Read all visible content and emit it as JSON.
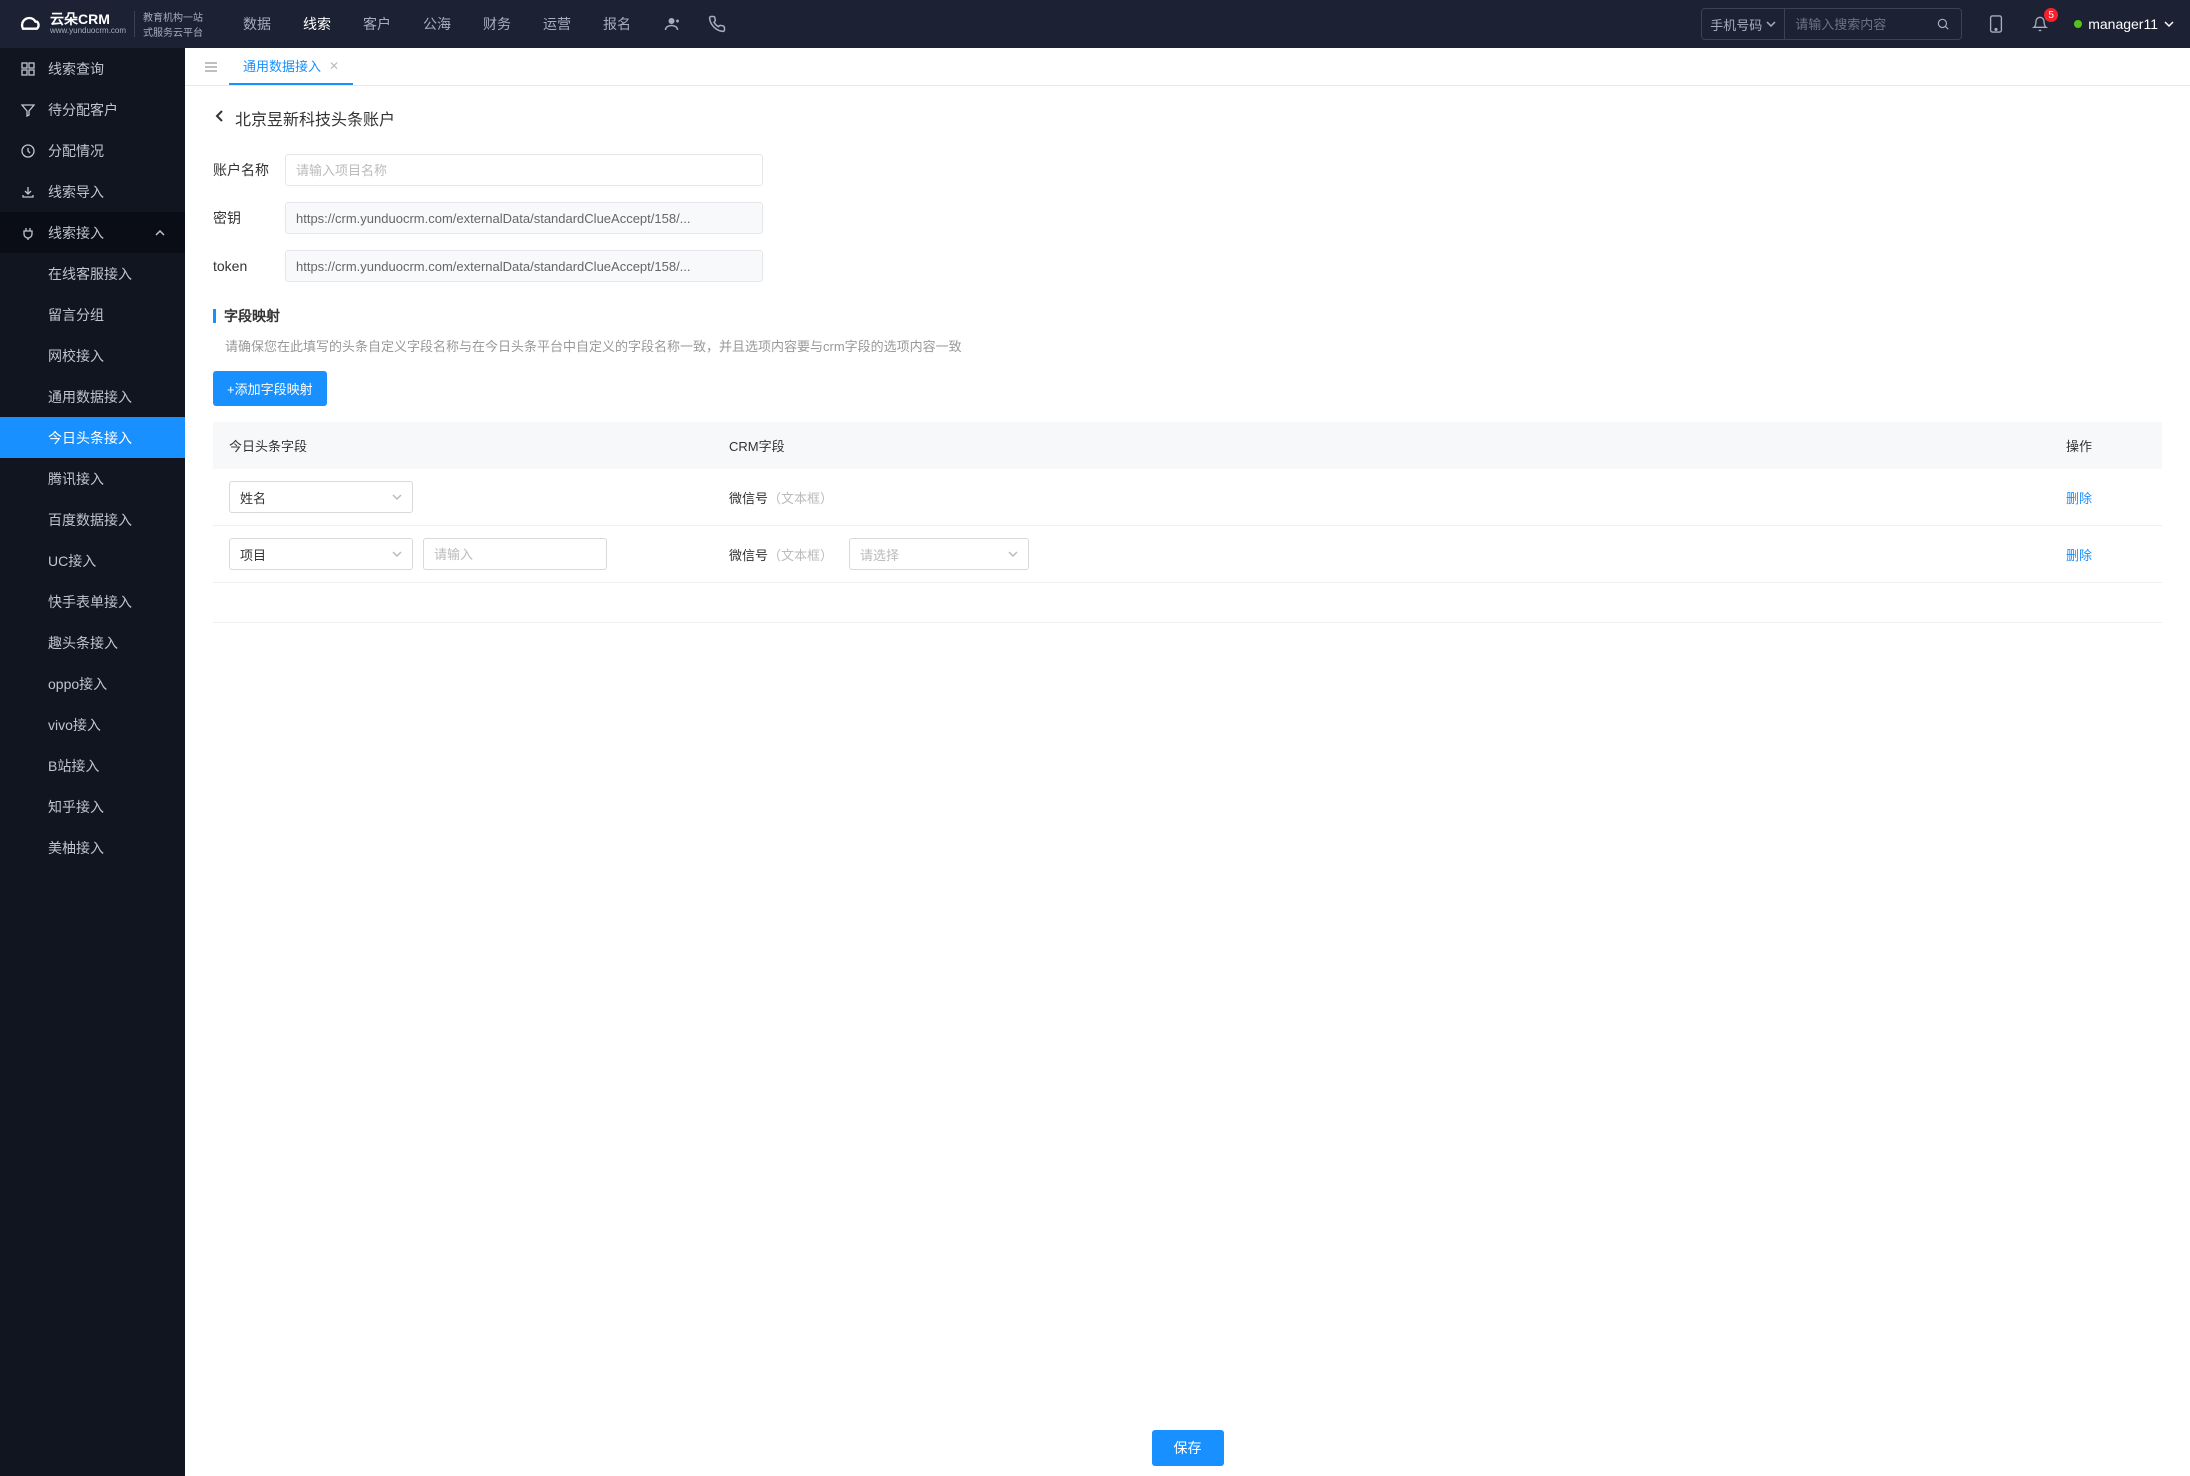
{
  "header": {
    "logo_main": "云朵CRM",
    "logo_sub_url": "www.yunduocrm.com",
    "logo_slogan1": "教育机构一站",
    "logo_slogan2": "式服务云平台",
    "nav": [
      "数据",
      "线索",
      "客户",
      "公海",
      "财务",
      "运营",
      "报名"
    ],
    "nav_active": 1,
    "search_type": "手机号码",
    "search_placeholder": "请输入搜索内容",
    "badge_count": "5",
    "user_name": "manager11"
  },
  "sidebar": {
    "items": [
      {
        "label": "线索查询",
        "icon": "grid"
      },
      {
        "label": "待分配客户",
        "icon": "filter"
      },
      {
        "label": "分配情况",
        "icon": "clock"
      },
      {
        "label": "线索导入",
        "icon": "export"
      },
      {
        "label": "线索接入",
        "icon": "plug",
        "expanded": true
      },
      {
        "label": "在线客服接入",
        "indent": true
      },
      {
        "label": "留言分组",
        "indent": true
      },
      {
        "label": "网校接入",
        "indent": true
      },
      {
        "label": "通用数据接入",
        "indent": true
      },
      {
        "label": "今日头条接入",
        "indent": true,
        "active": true
      },
      {
        "label": "腾讯接入",
        "indent": true
      },
      {
        "label": "百度数据接入",
        "indent": true
      },
      {
        "label": "UC接入",
        "indent": true
      },
      {
        "label": "快手表单接入",
        "indent": true
      },
      {
        "label": "趣头条接入",
        "indent": true
      },
      {
        "label": "oppo接入",
        "indent": true
      },
      {
        "label": "vivo接入",
        "indent": true
      },
      {
        "label": "B站接入",
        "indent": true
      },
      {
        "label": "知乎接入",
        "indent": true
      },
      {
        "label": "美柚接入",
        "indent": true
      }
    ]
  },
  "tabs": {
    "items": [
      {
        "label": "通用数据接入",
        "active": true
      }
    ]
  },
  "page": {
    "title": "北京昱新科技头条账户",
    "form": {
      "account_label": "账户名称",
      "account_placeholder": "请输入项目名称",
      "secret_label": "密钥",
      "secret_value": "https://crm.yunduocrm.com/externalData/standardClueAccept/158/...",
      "token_label": "token",
      "token_value": "https://crm.yunduocrm.com/externalData/standardClueAccept/158/..."
    },
    "section": {
      "title": "字段映射",
      "desc": "请确保您在此填写的头条自定义字段名称与在今日头条平台中自定义的字段名称一致，并且选项内容要与crm字段的选项内容一致",
      "add_btn": "+添加字段映射"
    },
    "table": {
      "headers": {
        "col1": "今日头条字段",
        "col2": "CRM字段",
        "col3": "操作"
      },
      "rows": [
        {
          "tt_field": "姓名",
          "crm_name": "微信号",
          "crm_type": "（文本框）",
          "del": "删除"
        },
        {
          "tt_field": "项目",
          "input_ph": "请输入",
          "crm_name": "微信号",
          "crm_type": "（文本框）",
          "select_ph": "请选择",
          "del": "删除"
        }
      ]
    },
    "save_btn": "保存"
  }
}
